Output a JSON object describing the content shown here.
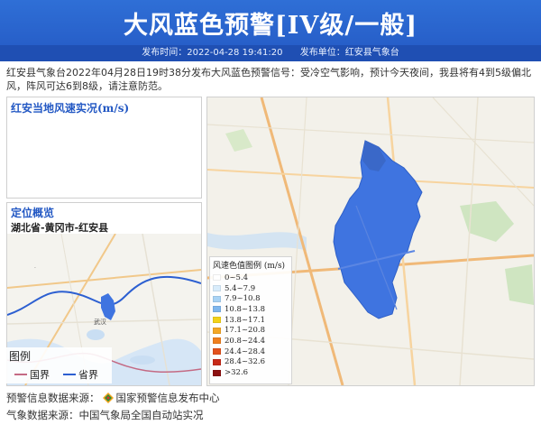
{
  "banner": {
    "title": "大风蓝色预警[IV级/一般]",
    "publish_time_label": "发布时间：2022-04-28 19:41:20",
    "publish_unit_label": "发布单位：红安县气象台"
  },
  "description": "红安县气象台2022年04月28日19时38分发布大风蓝色预警信号：受冷空气影响，预计今天夜间，我县将有4到5级偏北风，阵风可达6到8级，请注意防范。",
  "wind_panel": {
    "title": "红安当地风速实况(m/s)"
  },
  "location_panel": {
    "title": "定位概览",
    "place": "湖北省-黄冈市-红安县"
  },
  "boundary_legend": {
    "title": "图例",
    "items": [
      {
        "label": "国界",
        "color": "#c46a84"
      },
      {
        "label": "省界",
        "color": "#2c5fd1"
      }
    ]
  },
  "wind_legend": {
    "title": "风速色值图例 (m/s)",
    "items": [
      {
        "label": "0~5.4",
        "color": "#ffffff"
      },
      {
        "label": "5.4~7.9",
        "color": "#d8ecfb"
      },
      {
        "label": "7.9~10.8",
        "color": "#a9d3f5"
      },
      {
        "label": "10.8~13.8",
        "color": "#7fb7ee"
      },
      {
        "label": "13.8~17.1",
        "color": "#f2d21a"
      },
      {
        "label": "17.1~20.8",
        "color": "#f3a726"
      },
      {
        "label": "20.8~24.4",
        "color": "#ef7f1f"
      },
      {
        "label": "24.4~28.4",
        "color": "#e2521d"
      },
      {
        "label": "28.4~32.6",
        "color": "#c72a19"
      },
      {
        "label": ">32.6",
        "color": "#8c1010"
      }
    ]
  },
  "minimap_labels": {
    "city": "武汉"
  },
  "footer": {
    "source_warning": "预警信息数据来源：",
    "source_warning_org": "国家预警信息发布中心",
    "source_weather": "气象数据来源：中国气象局全国自动站实况"
  },
  "colors": {
    "banner": "#2459c4",
    "region": "#3f74e0",
    "accent": "#2459c4"
  }
}
